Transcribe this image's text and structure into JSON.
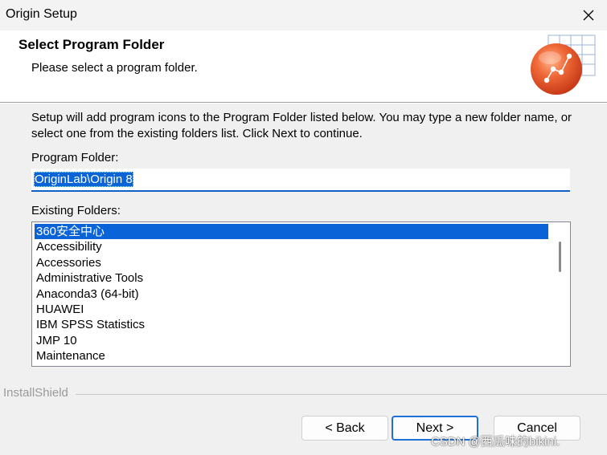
{
  "window": {
    "title": "Origin Setup"
  },
  "header": {
    "title": "Select Program Folder",
    "subtitle": "Please select a program folder."
  },
  "description": "Setup will add program icons to the Program Folder listed below.  You may type a new folder name, or select one from the existing folders list.  Click Next to continue.",
  "program_folder": {
    "label": "Program Folder:",
    "value": "OriginLab\\Origin 8"
  },
  "existing_folders": {
    "label": "Existing Folders:",
    "items": [
      "360安全中心",
      "Accessibility",
      "Accessories",
      "Administrative Tools",
      "Anaconda3 (64-bit)",
      "HUAWEI",
      "IBM SPSS Statistics",
      "JMP 10",
      "Maintenance"
    ],
    "selected_index": 0
  },
  "footer": {
    "brand": "InstallShield"
  },
  "buttons": {
    "back": "< Back",
    "next": "Next >",
    "cancel": "Cancel"
  },
  "watermark": "CSDN @西瓜味的bikini.",
  "colors": {
    "selection": "#0a64d8",
    "default_button_border": "#1e6fd6",
    "logo_orange": "#e8502a"
  },
  "icons": {
    "close": "close-icon",
    "logo": "origin-chart-logo-icon"
  }
}
